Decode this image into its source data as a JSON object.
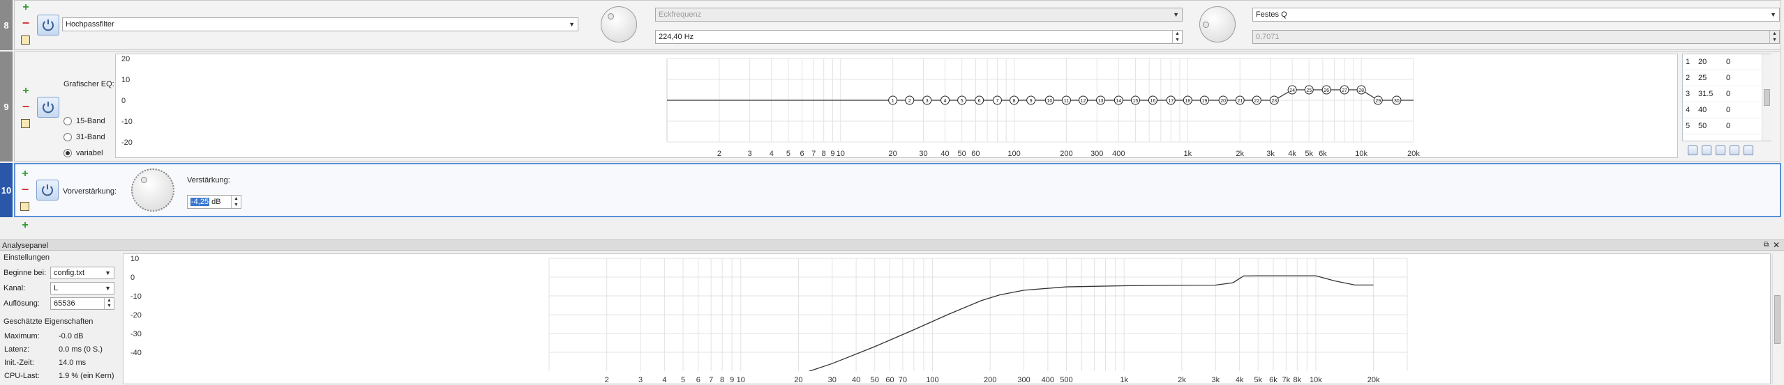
{
  "rows": {
    "r8": {
      "num": "8",
      "filter_type": "Hochpassfilter",
      "param1_label": "Eckfrequenz",
      "param1_value": "224,40 Hz",
      "param2_label": "Festes Q",
      "param2_value": "0,7071"
    },
    "r9": {
      "num": "9",
      "label": "Grafischer EQ:",
      "radios": [
        "15-Band",
        "31-Band",
        "variabel"
      ],
      "selected_radio": "variabel",
      "y_ticks": [
        "20",
        "10",
        "0",
        "-10",
        "-20"
      ],
      "x_ticks": [
        "2",
        "3",
        "4",
        "5",
        "6",
        "7",
        "8",
        "9",
        "10",
        "20",
        "30",
        "40",
        "50",
        "60",
        "100",
        "200",
        "300",
        "400",
        "1k",
        "2k",
        "3k",
        "4k",
        "5k",
        "6k",
        "10k",
        "20k"
      ],
      "band_freqs": [
        20,
        25,
        31.5,
        40,
        50,
        63,
        80,
        100,
        125,
        160,
        200,
        250,
        315,
        400,
        500,
        630,
        800,
        1000,
        1250,
        1600,
        2000,
        2500,
        3150,
        4000,
        5000,
        6300,
        8000,
        10000,
        12500,
        16000
      ],
      "band_gains": [
        0,
        0,
        0,
        0,
        0,
        0,
        0,
        0,
        0,
        0,
        0,
        0,
        0,
        0,
        0,
        0,
        0,
        0,
        0,
        0,
        0,
        0,
        0,
        5,
        5,
        5,
        5,
        5,
        0,
        0
      ],
      "band_labels": [
        "1",
        "2",
        "3",
        "4",
        "5",
        "6",
        "7",
        "8",
        "9",
        "10",
        "11",
        "12",
        "13",
        "14",
        "15",
        "16",
        "17",
        "18",
        "19",
        "20",
        "21",
        "22",
        "23",
        "24",
        "25",
        "26",
        "27",
        "28",
        "29",
        "30"
      ],
      "table": [
        {
          "n": "1",
          "f": "20",
          "g": "0"
        },
        {
          "n": "2",
          "f": "25",
          "g": "0"
        },
        {
          "n": "3",
          "f": "31.5",
          "g": "0"
        },
        {
          "n": "4",
          "f": "40",
          "g": "0"
        },
        {
          "n": "5",
          "f": "50",
          "g": "0"
        }
      ]
    },
    "r10": {
      "num": "10",
      "label": "Vorverstärkung:",
      "gain_label": "Verstärkung:",
      "gain_value": "-4,25",
      "gain_unit": "dB"
    }
  },
  "analyse": {
    "title": "Analysepanel",
    "settings_title": "Einstellungen",
    "start_label": "Beginne bei:",
    "start_value": "config.txt",
    "channel_label": "Kanal:",
    "channel_value": "L",
    "resolution_label": "Auflösung:",
    "resolution_value": "65536",
    "props_title": "Geschätzte Eigenschaften",
    "props": [
      {
        "k": "Maximum:",
        "v": "-0.0 dB"
      },
      {
        "k": "Latenz:",
        "v": "0.0 ms (0 S.)"
      },
      {
        "k": "Init.-Zeit:",
        "v": "14.0 ms"
      },
      {
        "k": "CPU-Last:",
        "v": "1.9 % (ein Kern)"
      }
    ]
  },
  "chart_data": {
    "type": "line",
    "title": "",
    "xlabel": "",
    "ylabel": "",
    "x_scale": "log",
    "xlim": [
      1,
      30000
    ],
    "ylim": [
      -50,
      10
    ],
    "y_ticks": [
      "10",
      "0",
      "-10",
      "-20",
      "-30",
      "-40"
    ],
    "x_ticks": [
      "2",
      "3",
      "4",
      "5",
      "6",
      "7",
      "8",
      "9",
      "10",
      "20",
      "30",
      "40",
      "50",
      "60",
      "70",
      "100",
      "200",
      "300",
      "400",
      "500",
      "1k",
      "2k",
      "3k",
      "4k",
      "5k",
      "6k",
      "7k",
      "8k",
      "10k",
      "20k"
    ],
    "grid": true,
    "series": [
      {
        "x": [
          20,
          30,
          50,
          80,
          120,
          180,
          224,
          300,
          500,
          1000,
          2000,
          3000,
          3700,
          4200,
          5000,
          8000,
          10000,
          12500,
          16000,
          20000
        ],
        "y": [
          -52,
          -46,
          -37,
          -28,
          -20,
          -12.5,
          -9.5,
          -7,
          -5.2,
          -4.6,
          -4.3,
          -4.25,
          -3,
          0.6,
          0.7,
          0.7,
          0.7,
          -2,
          -4.2,
          -4.2
        ]
      }
    ]
  },
  "colors": {
    "active_accent": "#2a57a8",
    "plus": "#2e9c2e",
    "minus": "#d23b3b"
  },
  "icons": [
    "plus-icon",
    "minus-icon",
    "edit-icon",
    "power-icon",
    "chevron-down-icon",
    "restore-icon",
    "close-icon"
  ]
}
